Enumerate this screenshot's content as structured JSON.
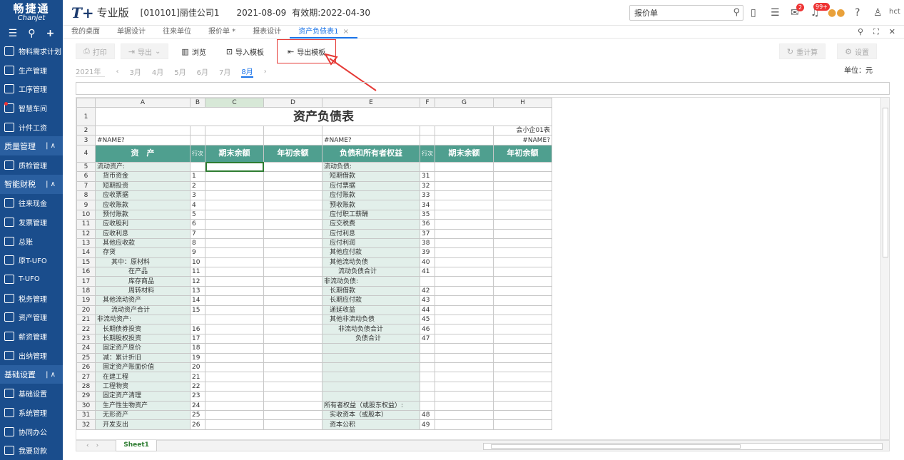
{
  "header": {
    "brand_cn": "畅捷通",
    "brand_en": "Chanjet",
    "product": "T+",
    "edition": "专业版",
    "company": "[010101]丽佳公司1",
    "date": "2021-08-09",
    "expire": "有效期:2022-04-30",
    "search_value": "报价单",
    "badge_msgs": "2",
    "badge_notes": "99+",
    "user": "hct"
  },
  "sidebar": {
    "items": [
      {
        "label": "物料需求计划",
        "type": "item"
      },
      {
        "label": "生产管理",
        "type": "item"
      },
      {
        "label": "工序管理",
        "type": "item"
      },
      {
        "label": "智慧车间",
        "type": "item",
        "dot": true
      },
      {
        "label": "计件工资",
        "type": "item"
      },
      {
        "label": "质量管理",
        "type": "section"
      },
      {
        "label": "质检管理",
        "type": "item"
      },
      {
        "label": "智能财税",
        "type": "section"
      },
      {
        "label": "往来现金",
        "type": "item"
      },
      {
        "label": "发票管理",
        "type": "item"
      },
      {
        "label": "总账",
        "type": "item"
      },
      {
        "label": "原T-UFO",
        "type": "item"
      },
      {
        "label": "T-UFO",
        "type": "item"
      },
      {
        "label": "税务管理",
        "type": "item"
      },
      {
        "label": "资产管理",
        "type": "item"
      },
      {
        "label": "薪资管理",
        "type": "item"
      },
      {
        "label": "出纳管理",
        "type": "item"
      },
      {
        "label": "基础设置",
        "type": "section"
      },
      {
        "label": "基础设置",
        "type": "item"
      },
      {
        "label": "系统管理",
        "type": "item"
      },
      {
        "label": "协同办公",
        "type": "item"
      },
      {
        "label": "我要贷款",
        "type": "item"
      }
    ]
  },
  "tabs": [
    "我的桌面",
    "单据设计",
    "往来单位",
    "报价单 *",
    "报表设计",
    "资产负债表1"
  ],
  "toolbar": {
    "print": "打印",
    "export": "导出",
    "browse": "浏览",
    "import_tpl": "导入模板",
    "export_tpl": "导出模板",
    "recalc": "重计算",
    "settings": "设置"
  },
  "period": {
    "year": "2021年",
    "months": [
      "3月",
      "4月",
      "5月",
      "6月",
      "7月",
      "8月"
    ],
    "active": "8月"
  },
  "unit": "单位：元",
  "sheet": {
    "columns": [
      "A",
      "B",
      "C",
      "D",
      "E",
      "F",
      "G",
      "H"
    ],
    "title": "资产负债表",
    "code": "会小企01表",
    "name_err": "#NAME?",
    "headers": [
      "资　产",
      "行次",
      "期末余额",
      "年初余额",
      "负债和所有者权益",
      "行次",
      "期末余额",
      "年初余额"
    ],
    "rows": [
      {
        "n": "5",
        "a": "流动资产:",
        "ai": 0,
        "b": "",
        "e": "流动负债:",
        "ei": 0,
        "f": ""
      },
      {
        "n": "6",
        "a": "货币资金",
        "ai": 1,
        "b": "1",
        "e": "短期借款",
        "ei": 1,
        "f": "31"
      },
      {
        "n": "7",
        "a": "短期投资",
        "ai": 1,
        "b": "2",
        "e": "应付票据",
        "ei": 1,
        "f": "32"
      },
      {
        "n": "8",
        "a": "应收票据",
        "ai": 1,
        "b": "3",
        "e": "应付账款",
        "ei": 1,
        "f": "33"
      },
      {
        "n": "9",
        "a": "应收账款",
        "ai": 1,
        "b": "4",
        "e": "预收账款",
        "ei": 1,
        "f": "34"
      },
      {
        "n": "10",
        "a": "预付账款",
        "ai": 1,
        "b": "5",
        "e": "应付职工薪酬",
        "ei": 1,
        "f": "35"
      },
      {
        "n": "11",
        "a": "应收股利",
        "ai": 1,
        "b": "6",
        "e": "应交税费",
        "ei": 1,
        "f": "36"
      },
      {
        "n": "12",
        "a": "应收利息",
        "ai": 1,
        "b": "7",
        "e": "应付利息",
        "ei": 1,
        "f": "37"
      },
      {
        "n": "13",
        "a": "其他应收款",
        "ai": 1,
        "b": "8",
        "e": "应付利润",
        "ei": 1,
        "f": "38"
      },
      {
        "n": "14",
        "a": "存货",
        "ai": 1,
        "b": "9",
        "e": "其他应付款",
        "ei": 1,
        "f": "39"
      },
      {
        "n": "15",
        "a": "其中：原材料",
        "ai": 2,
        "b": "10",
        "e": "其他流动负债",
        "ei": 1,
        "f": "40"
      },
      {
        "n": "16",
        "a": "在产品",
        "ai": 3,
        "b": "11",
        "e": "流动负债合计",
        "ei": 2,
        "f": "41"
      },
      {
        "n": "17",
        "a": "库存商品",
        "ai": 3,
        "b": "12",
        "e": "非流动负债:",
        "ei": 0,
        "f": ""
      },
      {
        "n": "18",
        "a": "周转材料",
        "ai": 3,
        "b": "13",
        "e": "长期借款",
        "ei": 1,
        "f": "42"
      },
      {
        "n": "19",
        "a": "其他流动资产",
        "ai": 1,
        "b": "14",
        "e": "长期应付款",
        "ei": 1,
        "f": "43"
      },
      {
        "n": "20",
        "a": "流动资产合计",
        "ai": 2,
        "b": "15",
        "e": "递延收益",
        "ei": 1,
        "f": "44"
      },
      {
        "n": "21",
        "a": "非流动资产:",
        "ai": 0,
        "b": "",
        "e": "其他非流动负债",
        "ei": 1,
        "f": "45"
      },
      {
        "n": "22",
        "a": "长期债券投资",
        "ai": 1,
        "b": "16",
        "e": "非流动负债合计",
        "ei": 2,
        "f": "46"
      },
      {
        "n": "23",
        "a": "长期股权投资",
        "ai": 1,
        "b": "17",
        "e": "负债合计",
        "ei": 3,
        "f": "47"
      },
      {
        "n": "24",
        "a": "固定资产原价",
        "ai": 1,
        "b": "18",
        "e": "",
        "ei": 0,
        "f": ""
      },
      {
        "n": "25",
        "a": "减：累计折旧",
        "ai": 1,
        "b": "19",
        "e": "",
        "ei": 0,
        "f": ""
      },
      {
        "n": "26",
        "a": "固定资产账面价值",
        "ai": 1,
        "b": "20",
        "e": "",
        "ei": 0,
        "f": ""
      },
      {
        "n": "27",
        "a": "在建工程",
        "ai": 1,
        "b": "21",
        "e": "",
        "ei": 0,
        "f": ""
      },
      {
        "n": "28",
        "a": "工程物资",
        "ai": 1,
        "b": "22",
        "e": "",
        "ei": 0,
        "f": ""
      },
      {
        "n": "29",
        "a": "固定资产清理",
        "ai": 1,
        "b": "23",
        "e": "",
        "ei": 0,
        "f": ""
      },
      {
        "n": "30",
        "a": "生产性生物资产",
        "ai": 1,
        "b": "24",
        "e": "所有者权益（或股东权益）:",
        "ei": 0,
        "f": ""
      },
      {
        "n": "31",
        "a": "无形资产",
        "ai": 1,
        "b": "25",
        "e": "实收资本（或股本）",
        "ei": 1,
        "f": "48"
      },
      {
        "n": "32",
        "a": "开发支出",
        "ai": 1,
        "b": "26",
        "e": "资本公积",
        "ei": 1,
        "f": "49"
      }
    ]
  },
  "sheet_tab": "Sheet1"
}
